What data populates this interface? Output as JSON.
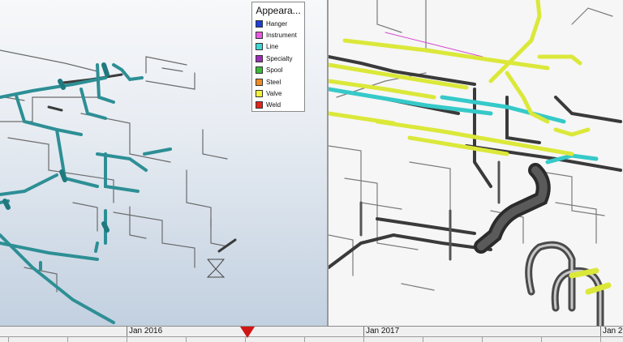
{
  "legend": {
    "title": "Appeara...",
    "items": [
      {
        "label": "Hanger",
        "color": "#1e3fd8"
      },
      {
        "label": "Instrument",
        "color": "#e85be0"
      },
      {
        "label": "Line",
        "color": "#3fd6d6"
      },
      {
        "label": "Specialty",
        "color": "#9b2fb5"
      },
      {
        "label": "Spool",
        "color": "#3dbb3a"
      },
      {
        "label": "Steel",
        "color": "#f08a24"
      },
      {
        "label": "Valve",
        "color": "#f2f23a"
      },
      {
        "label": "Weld",
        "color": "#e3241b"
      }
    ]
  },
  "timeline": {
    "years": [
      {
        "label": "Jan 2016"
      },
      {
        "label": "Jan 2017"
      },
      {
        "label": "Jan 2"
      }
    ]
  },
  "colors": {
    "pipe_teal": "#2d8f95",
    "pipe_gray": "#5a5a5a",
    "pipe_yellow": "#dbe83a",
    "pipe_cyan": "#36c9c9",
    "marker": "#d11515"
  }
}
